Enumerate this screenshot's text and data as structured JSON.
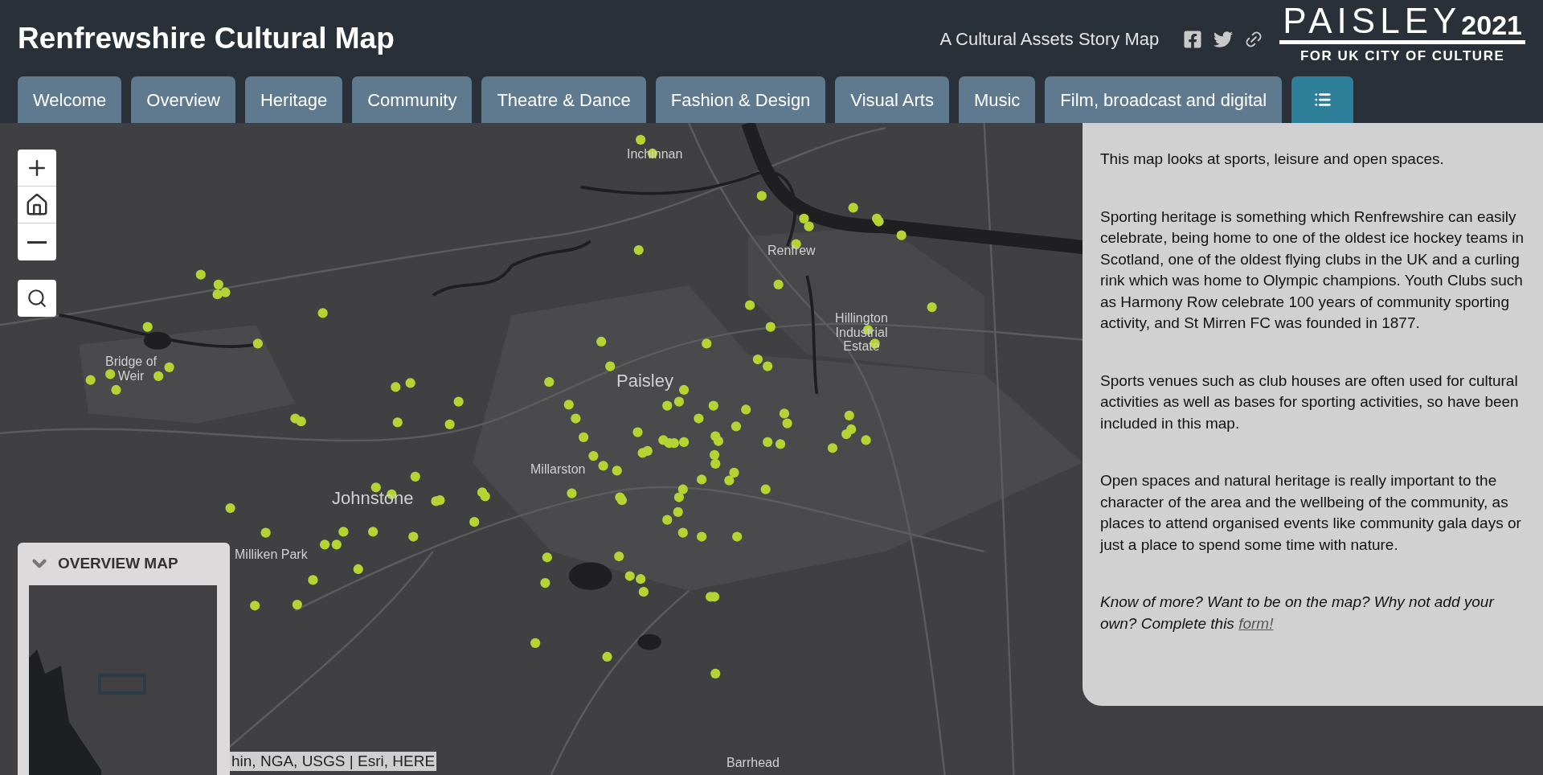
{
  "header": {
    "title": "Renfrewshire Cultural Map",
    "subtitle": "A Cultural Assets Story Map",
    "logo": {
      "word": "PAISLEY",
      "year": "2021",
      "tagline": "FOR UK CITY OF CULTURE"
    }
  },
  "tabs": [
    {
      "label": "Welcome",
      "selected": false
    },
    {
      "label": "Overview",
      "selected": false
    },
    {
      "label": "Heritage",
      "selected": false
    },
    {
      "label": "Community",
      "selected": false
    },
    {
      "label": "Theatre & Dance",
      "selected": false
    },
    {
      "label": "Fashion & Design",
      "selected": false
    },
    {
      "label": "Visual Arts",
      "selected": false
    },
    {
      "label": "Music",
      "selected": false
    },
    {
      "label": "Film, broadcast and digital",
      "selected": false
    }
  ],
  "map": {
    "place_labels": [
      "Inchinnan",
      "Renfrew",
      "Hillington Industrial Estate",
      "Bridge of Weir",
      "Paisley",
      "Millarston",
      "Johnstone",
      "Milliken Park",
      "Barrhead"
    ],
    "overview": {
      "title": "OVERVIEW MAP",
      "expanded": true
    },
    "attribution": "hin, NGA, USGS | Esri, HERE"
  },
  "panel": {
    "paragraphs": [
      "This map looks at sports, leisure and open spaces.",
      "Sporting heritage is something which Renfrewshire can easily celebrate, being home to one of the oldest ice hockey teams in Scotland, one of the oldest flying clubs in the UK and a curling rink which was home to Olympic champions. Youth Clubs such as Harmony Row celebrate 100 years of community sporting activity, and St Mirren FC was founded in 1877.",
      "Sports venues such as club houses are often used for cultural activities as well as bases for sporting activities, so have been included in this map.",
      "Open spaces and natural heritage is really important to the character of the area and the wellbeing of the community, as places to attend organised events like community gala days or just a place to spend some time with nature."
    ],
    "note": {
      "text": "Know of more? Want to be on the map? Why not add your own? Complete this",
      "link": "form!"
    }
  }
}
